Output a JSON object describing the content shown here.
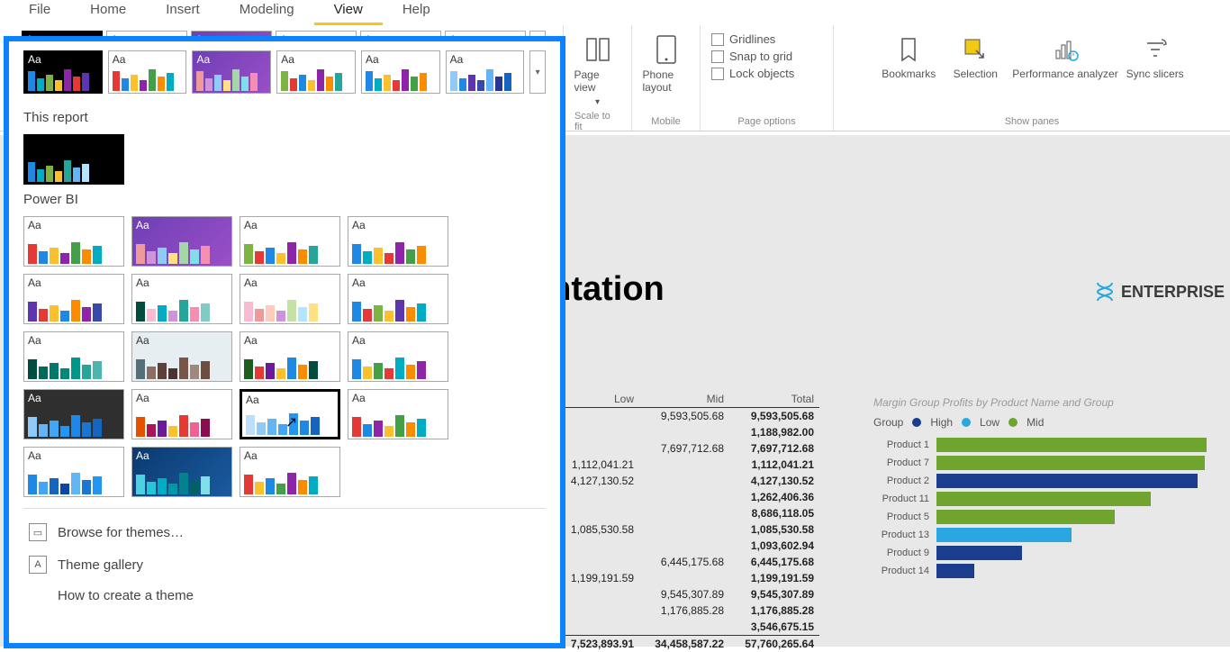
{
  "menu": {
    "items": [
      "File",
      "Home",
      "Insert",
      "Modeling",
      "View",
      "Help"
    ],
    "active": 4
  },
  "ribbon": {
    "groups": {
      "scale": {
        "label": "Scale to fit",
        "btn": {
          "label": "Page view",
          "sub": "▾"
        }
      },
      "mobile": {
        "label": "Mobile",
        "btn": {
          "label": "Phone layout"
        }
      },
      "options": {
        "label": "Page options",
        "checks": [
          "Gridlines",
          "Snap to grid",
          "Lock objects"
        ]
      },
      "panes": {
        "label": "Show panes",
        "btns": [
          "Bookmarks",
          "Selection",
          "Performance analyzer",
          "Sync slicers"
        ]
      }
    }
  },
  "themes": {
    "strip": [
      {
        "bg": "dark",
        "bars": [
          "#1e88e5",
          "#00acc1",
          "#7cb342",
          "#fbc02d",
          "#8e24aa",
          "#e53935",
          "#5e35b1"
        ]
      },
      {
        "bg": "",
        "bars": [
          "#e53935",
          "#1e88e5",
          "#fbc02d",
          "#8e24aa",
          "#43a047",
          "#fb8c00",
          "#00acc1"
        ]
      },
      {
        "bg": "purple",
        "bars": [
          "#ef9a9a",
          "#ce93d8",
          "#90caf9",
          "#ffe082",
          "#a5d6a7",
          "#80deea",
          "#f48fb1"
        ]
      },
      {
        "bg": "",
        "bars": [
          "#7cb342",
          "#e53935",
          "#1e88e5",
          "#fbc02d",
          "#8e24aa",
          "#fb8c00",
          "#26a69a"
        ]
      },
      {
        "bg": "",
        "bars": [
          "#1e88e5",
          "#00acc1",
          "#fbc02d",
          "#e53935",
          "#8e24aa",
          "#43a047",
          "#fb8c00"
        ]
      },
      {
        "bg": "",
        "bars": [
          "#90caf9",
          "#1e88e5",
          "#5e35b1",
          "#3949ab",
          "#64b5f6",
          "#283593",
          "#1565c0"
        ]
      }
    ],
    "dropdown": {
      "section1": "This report",
      "current": {
        "bg": "dark",
        "bars": [
          "#1e88e5",
          "#00acc1",
          "#7cb342",
          "#fbc02d",
          "#26a69a",
          "#64b5f6",
          "#b3e5fc"
        ]
      },
      "section2": "Power BI",
      "grid": [
        {
          "bg": "",
          "bars": [
            "#e53935",
            "#1e88e5",
            "#fbc02d",
            "#8e24aa",
            "#43a047",
            "#fb8c00",
            "#00acc1"
          ]
        },
        {
          "bg": "purple",
          "bars": [
            "#ef9a9a",
            "#ce93d8",
            "#90caf9",
            "#ffe082",
            "#a5d6a7",
            "#80deea",
            "#f48fb1"
          ]
        },
        {
          "bg": "",
          "bars": [
            "#7cb342",
            "#e53935",
            "#1e88e5",
            "#fbc02d",
            "#8e24aa",
            "#fb8c00",
            "#26a69a"
          ]
        },
        {
          "bg": "",
          "bars": [
            "#1e88e5",
            "#00acc1",
            "#fbc02d",
            "#e53935",
            "#8e24aa",
            "#43a047",
            "#fb8c00"
          ]
        },
        {
          "bg": "",
          "bars": [
            "#5e35b1",
            "#e53935",
            "#fbc02d",
            "#1e88e5",
            "#fb8c00",
            "#8e24aa",
            "#3949ab"
          ]
        },
        {
          "bg": "",
          "bars": [
            "#004d40",
            "#f8bbd0",
            "#00acc1",
            "#ce93d8",
            "#26a69a",
            "#f48fb1",
            "#80cbc4"
          ]
        },
        {
          "bg": "",
          "bars": [
            "#f8bbd0",
            "#ef9a9a",
            "#ffccbc",
            "#ce93d8",
            "#c5e1a5",
            "#b3e5fc",
            "#ffe082"
          ]
        },
        {
          "bg": "",
          "bars": [
            "#1e88e5",
            "#e53935",
            "#7cb342",
            "#fbc02d",
            "#5e35b1",
            "#fb8c00",
            "#00acc1"
          ]
        },
        {
          "bg": "",
          "bars": [
            "#004d40",
            "#00695c",
            "#00796b",
            "#00897b",
            "#009688",
            "#26a69a",
            "#4db6ac"
          ]
        },
        {
          "bg": "greyblue",
          "bars": [
            "#546e7a",
            "#8d6e63",
            "#5d4037",
            "#4e342e",
            "#795548",
            "#a1887f",
            "#6d4c41"
          ]
        },
        {
          "bg": "",
          "bars": [
            "#1b5e20",
            "#e53935",
            "#6a1b9a",
            "#fbc02d",
            "#1e88e5",
            "#fb8c00",
            "#004d40"
          ]
        },
        {
          "bg": "",
          "bars": [
            "#1e88e5",
            "#fbc02d",
            "#43a047",
            "#e53935",
            "#00acc1",
            "#fb8c00",
            "#8e24aa"
          ]
        },
        {
          "bg": "charcoal",
          "bars": [
            "#90caf9",
            "#64b5f6",
            "#42a5f5",
            "#2196f3",
            "#1e88e5",
            "#1976d2",
            "#1565c0"
          ]
        },
        {
          "bg": "",
          "bars": [
            "#e65100",
            "#ad1457",
            "#6a1b9a",
            "#fbc02d",
            "#e53935",
            "#f06292",
            "#880e4f"
          ]
        },
        {
          "bg": "",
          "sel": true,
          "bars": [
            "#bbdefb",
            "#90caf9",
            "#64b5f6",
            "#42a5f5",
            "#2196f3",
            "#1e88e5",
            "#1565c0"
          ]
        },
        {
          "bg": "",
          "bars": [
            "#e53935",
            "#1e88e5",
            "#8e24aa",
            "#fbc02d",
            "#43a047",
            "#fb8c00",
            "#00acc1"
          ]
        },
        {
          "bg": "",
          "bars": [
            "#1e88e5",
            "#42a5f5",
            "#1565c0",
            "#0d47a1",
            "#64b5f6",
            "#1976d2",
            "#2196f3"
          ]
        },
        {
          "bg": "navy",
          "bars": [
            "#4dd0e1",
            "#26c6da",
            "#00acc1",
            "#0097a7",
            "#00838f",
            "#006064",
            "#80deea"
          ]
        },
        {
          "bg": "",
          "bars": [
            "#e53935",
            "#fbc02d",
            "#1e88e5",
            "#43a047",
            "#8e24aa",
            "#fb8c00",
            "#00acc1"
          ]
        }
      ],
      "actions": [
        "Browse for themes…",
        "Theme gallery",
        "How to create a theme"
      ]
    }
  },
  "report": {
    "title_fragment": "entation",
    "brand": "ENTERPRISE",
    "table": {
      "headers": [
        "Low",
        "Mid",
        "Total"
      ],
      "rows": [
        [
          "",
          "9,593,505.68",
          "9,593,505.68"
        ],
        [
          "",
          "",
          "1,188,982.00"
        ],
        [
          "",
          "7,697,712.68",
          "7,697,712.68"
        ],
        [
          "1,112,041.21",
          "",
          "1,112,041.21"
        ],
        [
          "4,127,130.52",
          "",
          "4,127,130.52"
        ],
        [
          "",
          "",
          "1,262,406.36"
        ],
        [
          "",
          "",
          "8,686,118.05"
        ],
        [
          "1,085,530.58",
          "",
          "1,085,530.58"
        ],
        [
          "",
          "",
          "1,093,602.94"
        ],
        [
          "",
          "6,445,175.68",
          "6,445,175.68"
        ],
        [
          "1,199,191.59",
          "",
          "1,199,191.59"
        ],
        [
          "",
          "9,545,307.89",
          "9,545,307.89"
        ],
        [
          "",
          "1,176,885.28",
          "1,176,885.28"
        ],
        [
          "",
          "",
          "3,546,675.15"
        ]
      ],
      "total": [
        "7,523,893.91",
        "34,458,587.22",
        "57,760,265.64"
      ]
    }
  },
  "chart_data": {
    "type": "bar",
    "orientation": "horizontal",
    "title": "Margin Group Profits by Product Name and Group",
    "legend_label": "Group",
    "series_colors": {
      "High": "#1a3e8c",
      "Low": "#2aa7e0",
      "Mid": "#6fa52e"
    },
    "categories": [
      "Product 1",
      "Product 7",
      "Product 2",
      "Product 11",
      "Product 5",
      "Product 13",
      "Product 9",
      "Product 14"
    ],
    "values": [
      300,
      298,
      290,
      238,
      198,
      150,
      95,
      42
    ],
    "groups": [
      "Mid",
      "Mid",
      "High",
      "Mid",
      "Mid",
      "Low",
      "High",
      "High"
    ],
    "xmax": 300
  }
}
